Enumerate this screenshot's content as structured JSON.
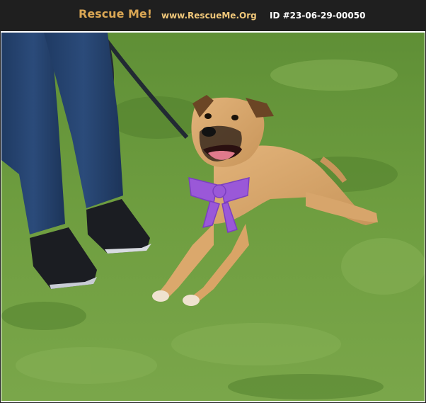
{
  "header": {
    "brand": "Rescue Me!",
    "site": "www.RescueMe.Org",
    "listing_id": "ID #23-06-29-00050"
  },
  "colors": {
    "header_bg": "#1f1f1f",
    "brand": "#d9a654",
    "site": "#f0c77a",
    "id_text": "#ffffff",
    "grass": "#6f9a3e",
    "ribbon": "#9a58d8"
  },
  "photo": {
    "subject": "tan dog lying on grass wearing a purple bow, person in jeans holding a leash"
  }
}
